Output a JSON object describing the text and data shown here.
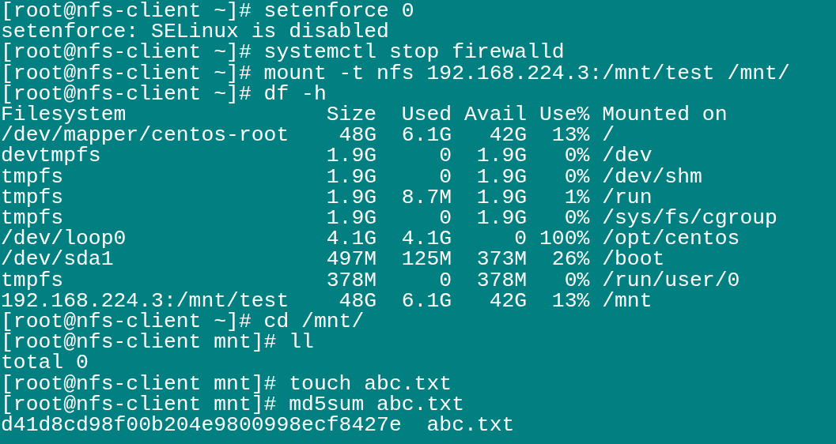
{
  "terminal": {
    "lines": [
      "[root@nfs-client ~]# setenforce 0",
      "setenforce: SELinux is disabled",
      "[root@nfs-client ~]# systemctl stop firewalld",
      "[root@nfs-client ~]# mount -t nfs 192.168.224.3:/mnt/test /mnt/",
      "[root@nfs-client ~]# df -h",
      "Filesystem                Size  Used Avail Use% Mounted on",
      "/dev/mapper/centos-root    48G  6.1G   42G  13% /",
      "devtmpfs                  1.9G     0  1.9G   0% /dev",
      "tmpfs                     1.9G     0  1.9G   0% /dev/shm",
      "tmpfs                     1.9G  8.7M  1.9G   1% /run",
      "tmpfs                     1.9G     0  1.9G   0% /sys/fs/cgroup",
      "/dev/loop0                4.1G  4.1G     0 100% /opt/centos",
      "/dev/sda1                 497M  125M  373M  26% /boot",
      "tmpfs                     378M     0  378M   0% /run/user/0",
      "192.168.224.3:/mnt/test    48G  6.1G   42G  13% /mnt",
      "[root@nfs-client ~]# cd /mnt/",
      "[root@nfs-client mnt]# ll",
      "total 0",
      "[root@nfs-client mnt]# touch abc.txt",
      "[root@nfs-client mnt]# md5sum abc.txt",
      "d41d8cd98f00b204e9800998ecf8427e  abc.txt"
    ]
  }
}
